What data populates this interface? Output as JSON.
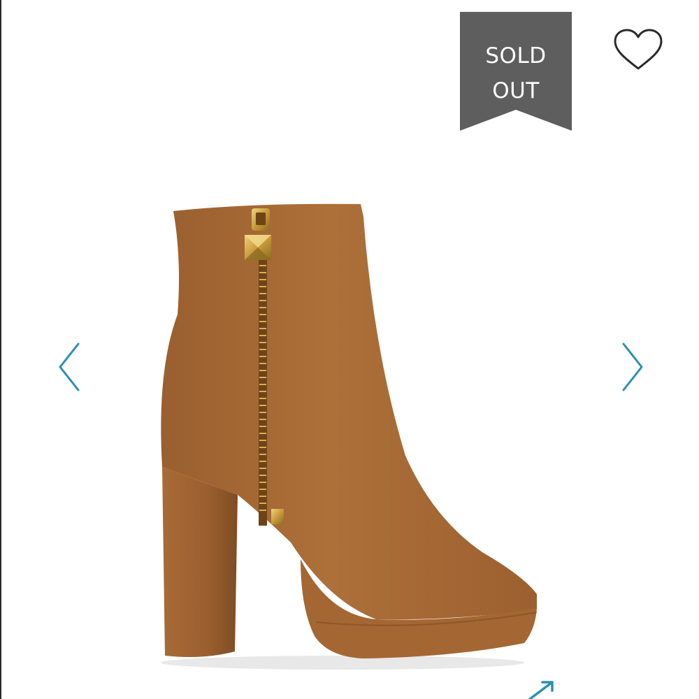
{
  "badge": {
    "label": "SOLD\nOUT",
    "color": "#5e5e5e"
  },
  "icons": {
    "favorite": "heart-outline-icon",
    "previous": "chevron-left-icon",
    "next": "chevron-right-icon",
    "zoom": "expand-arrows-icon"
  },
  "colors": {
    "accent": "#2b8fb4",
    "suede": "#a76a37",
    "zipper": "#caa244"
  },
  "product": {
    "image_subject": "tan-suede-platform-ankle-boot"
  }
}
